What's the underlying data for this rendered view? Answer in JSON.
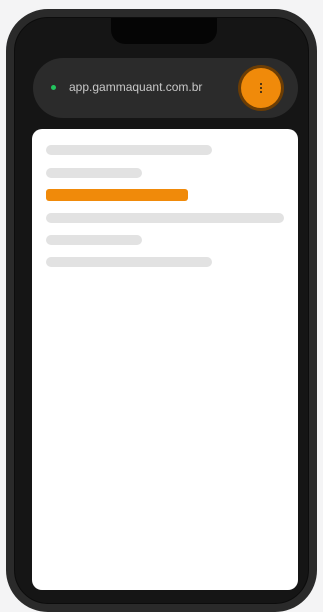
{
  "browser": {
    "url": "app.gammaquant.com.br",
    "status": "online",
    "menu_icon": "vertical-ellipsis-icon"
  },
  "content": {
    "state": "loading-skeleton",
    "accent_color": "#f08a0a",
    "placeholder_color": "#e2e2e2"
  }
}
